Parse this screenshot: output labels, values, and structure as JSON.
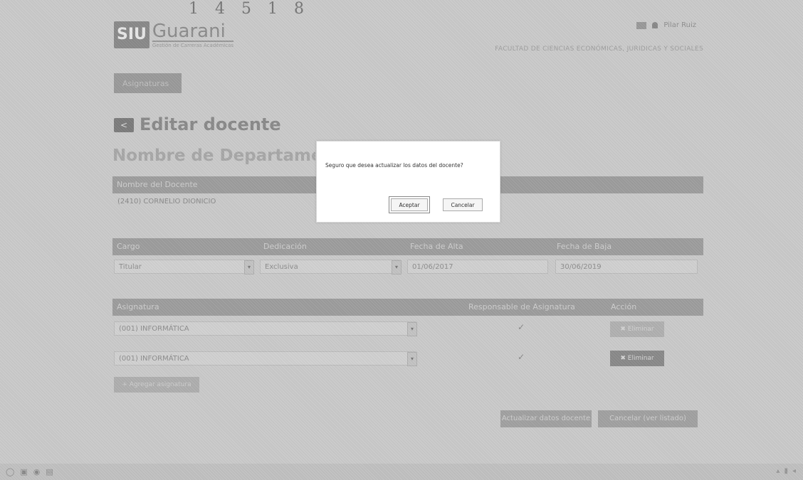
{
  "header": {
    "logo_siu": "SIU",
    "logo_name": "Guarani",
    "logo_sub": "Gestión de Carreras Académicas",
    "lang": "",
    "user": "Pilar Ruiz",
    "department_header": "FACULTAD DE CIENCIAS ECONÓMICAS, JURIDICAS Y SOCIALES"
  },
  "nav": {
    "button_label": "Asignaturas"
  },
  "page": {
    "back_label": "<",
    "title": "Editar docente",
    "department": "Nombre de Departamento:INFORMÁTICA"
  },
  "docente": {
    "header": "Nombre del Docente",
    "value": "(2410) CORNELIO DIONICIO"
  },
  "cargo_table": {
    "headers": [
      "Cargo",
      "Dedicación",
      "Fecha de Alta",
      "Fecha de Baja"
    ],
    "cargo": "Titular",
    "dedicacion": "Exclusiva",
    "fecha_alta": "01/06/2017",
    "fecha_baja": "30/06/2019"
  },
  "asignaturas": {
    "headers": [
      "Asignatura",
      "Responsable de Asignatura",
      "Acción"
    ],
    "rows": [
      {
        "name": "(001) INFORMÁTICA",
        "responsible": "✓",
        "action": "✖ Eliminar"
      },
      {
        "name": "(001) INFORMÁTICA",
        "responsible": "✓",
        "action": "✖ Eliminar"
      }
    ],
    "add_label": "+ Agregar asignatura"
  },
  "footer_buttons": {
    "save": "Actualizar datos docente",
    "cancel": "Cancelar (ver listado)"
  },
  "modal": {
    "message": "Seguro que desea actualizar los datos del docente?",
    "accept": "Aceptar",
    "cancel": "Cancelar"
  },
  "scribble": "1 4 5   1 8",
  "colors": {
    "backdrop": "#cbcbcb",
    "modal_bg": "#ffffff",
    "header_bar": "#9e9e9e"
  }
}
